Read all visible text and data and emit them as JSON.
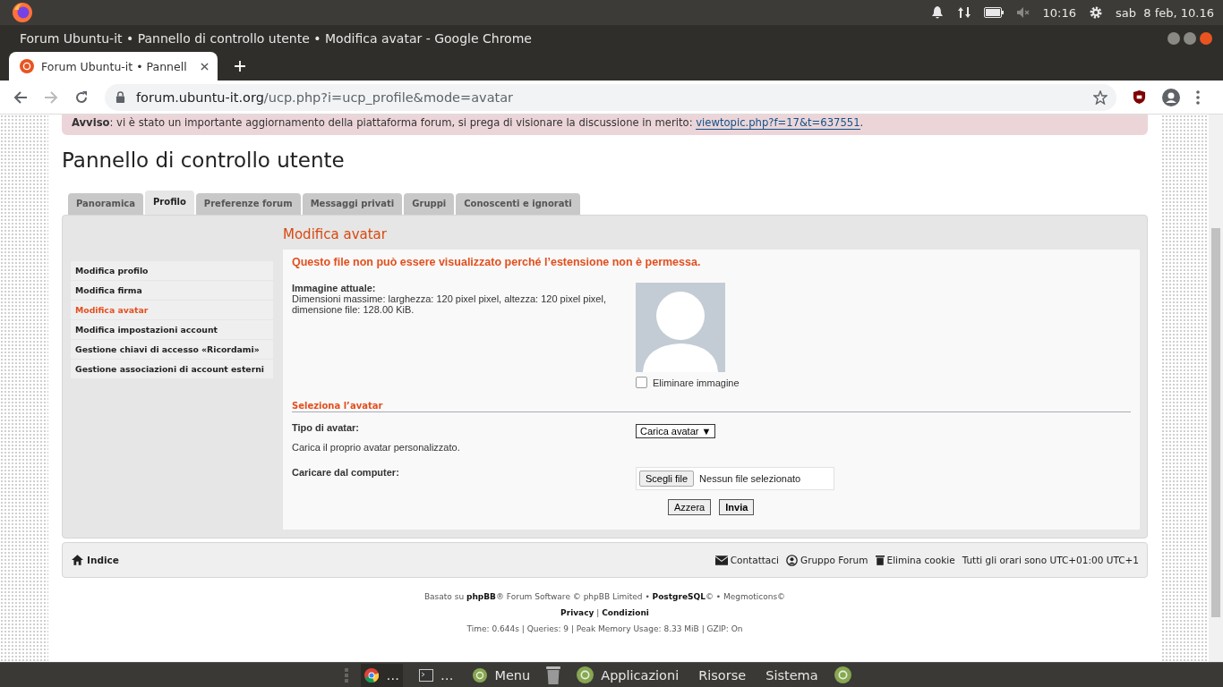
{
  "top_panel": {
    "clock": "10:16",
    "date": "sab  8 feb, 10.16"
  },
  "window": {
    "title": "Forum Ubuntu-it • Pannello di controllo utente • Modifica avatar - Google Chrome",
    "tabs": [
      {
        "label": "Forum Ubuntu-it • Pannell",
        "selected": true
      }
    ],
    "address": {
      "domain": "forum.ubuntu-it.org",
      "path": "/ucp.php?i=ucp_profile&mode=avatar"
    }
  },
  "notice": {
    "label": "Avviso",
    "text": ": vi è stato un importante aggiornamento della piattaforma forum, si prega di visionare la discussione in merito: ",
    "link": "viewtopic.php?f=17&t=637551",
    "tail": "."
  },
  "page_title": "Pannello di controllo utente",
  "tabs": [
    {
      "label": "Panoramica",
      "selected": false
    },
    {
      "label": "Profilo",
      "selected": true
    },
    {
      "label": "Preferenze forum",
      "selected": false
    },
    {
      "label": "Messaggi privati",
      "selected": false
    },
    {
      "label": "Gruppi",
      "selected": false
    },
    {
      "label": "Conoscenti e ignorati",
      "selected": false
    }
  ],
  "sidebar": {
    "items": [
      {
        "label": "Modifica profilo",
        "selected": false
      },
      {
        "label": "Modifica firma",
        "selected": false
      },
      {
        "label": "Modifica avatar",
        "selected": true
      },
      {
        "label": "Modifica impostazioni account",
        "selected": false
      },
      {
        "label": "Gestione chiavi di accesso «Ricordami»",
        "selected": false
      },
      {
        "label": "Gestione associazioni di account esterni",
        "selected": false
      }
    ]
  },
  "panel": {
    "heading": "Modifica avatar",
    "error": "Questo file non può essere visualizzato perché l’estensione non è permessa.",
    "current_image": {
      "label": "Immagine attuale:",
      "description": "Dimensioni massime: larghezza: 120 pixel pixel, altezza: 120 pixel pixel, dimensione file: 128.00 KiB.",
      "delete": {
        "label": "Eliminare immagine",
        "checked": false
      }
    },
    "section_heading": "Seleziona l’avatar",
    "avatar_type": {
      "label": "Tipo di avatar:",
      "value": "Carica avatar",
      "arrow": "▼",
      "description": "Carica il proprio avatar personalizzato."
    },
    "upload": {
      "label": "Caricare dal computer:",
      "button": "Scegli file",
      "status": "Nessun file selezionato"
    },
    "buttons": [
      {
        "label": "Azzera",
        "kind": "reset"
      },
      {
        "label": "Invia",
        "kind": "submit"
      }
    ]
  },
  "footer_nav": {
    "home": "Indice",
    "links": [
      {
        "label": "Contattaci",
        "kind": "mail"
      },
      {
        "label": "Gruppo Forum",
        "kind": "user"
      },
      {
        "label": "Elimina cookie",
        "kind": "trash"
      }
    ],
    "timezone": "Tutti gli orari sono UTC+01:00 UTC+1"
  },
  "credits": {
    "line": "Basato su **phpBB**® Forum Software © phpBB Limited • **PostgreSQL**© • Megmoticons©",
    "links": [
      "Privacy",
      "Condizioni"
    ],
    "separator": "|",
    "stats": "Time: 0.644s | Queries: 9 | Peak Memory Usage: 8.33 MiB | GZIP: On"
  },
  "taskbar": {
    "items": [
      {
        "kind": "chrome",
        "label": "…"
      },
      {
        "kind": "terminal",
        "label": "…"
      },
      {
        "kind": "menu",
        "label": "Menu"
      },
      {
        "kind": "trash"
      },
      {
        "kind": "apps",
        "label": "Applicazioni"
      },
      {
        "kind": "text",
        "label": "Risorse"
      },
      {
        "kind": "text",
        "label": "Sistema"
      },
      {
        "kind": "logo"
      }
    ]
  }
}
